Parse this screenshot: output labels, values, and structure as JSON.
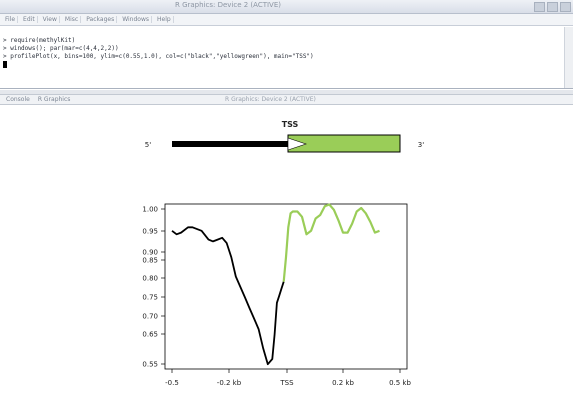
{
  "window": {
    "title": "R Graphics: Device 2 (ACTIVE)"
  },
  "menubar": [
    "File",
    "Edit",
    "View",
    "Misc",
    "Packages",
    "Windows",
    "Help"
  ],
  "console": {
    "lines": [
      "> require(methylKit)",
      "> windows(); par(mar=c(4,4,2,2))",
      "> profilePlot(x, bins=100, ylim=c(0.55,1.0), col=c(\"black\",\"yellowgreen\"), main=\"TSS\")"
    ]
  },
  "graph_tabs": {
    "items": [
      "Console",
      "R Graphics"
    ],
    "center": "R Graphics: Device 2 (ACTIVE)"
  },
  "gene_model": {
    "title": "TSS",
    "left_label": "5'",
    "right_label": "3'"
  },
  "chart_data": {
    "type": "line",
    "title": "",
    "xlabel": "",
    "ylabel": "",
    "x_tick_labels": [
      "-0.5",
      "-0.2 kb",
      "TSS",
      "0.2 kb",
      "0.5 kb"
    ],
    "y_tick_labels": [
      "0.55",
      "0.65",
      "0.70",
      "0.75",
      "0.80",
      "0.85",
      "0.90",
      "0.95",
      "1.00"
    ],
    "ylim": [
      0.55,
      1.0
    ],
    "x": [
      0,
      0.02,
      0.04,
      0.07,
      0.09,
      0.13,
      0.16,
      0.18,
      0.2,
      0.22,
      0.24,
      0.26,
      0.28,
      0.3,
      0.32,
      0.34,
      0.36,
      0.38,
      0.4,
      0.42,
      0.44,
      0.45,
      0.46,
      0.47,
      0.48,
      0.49,
      0.5,
      0.51,
      0.52,
      0.53,
      0.55,
      0.57,
      0.59,
      0.61,
      0.63,
      0.65,
      0.67,
      0.69,
      0.71,
      0.73,
      0.75,
      0.77,
      0.79,
      0.81,
      0.83,
      0.85,
      0.87,
      0.89,
      0.91,
      0.93,
      0.95,
      0.97,
      0.99,
      1.0
    ],
    "series": [
      {
        "color": "#000000",
        "range": [
          0,
          0.49
        ],
        "values": [
          0.935,
          0.925,
          0.93,
          0.945,
          0.945,
          0.935,
          0.91,
          0.905,
          0.91,
          0.915,
          0.9,
          0.86,
          0.805,
          0.775,
          0.745,
          0.715,
          0.685,
          0.655,
          0.6,
          0.555,
          0.57,
          0.64,
          0.73,
          0.75,
          0.77,
          0.79
        ]
      },
      {
        "color": "#9acd58",
        "range": [
          0.49,
          1.0
        ],
        "values": [
          0.79,
          0.86,
          0.945,
          0.985,
          0.99,
          0.99,
          0.975,
          0.925,
          0.935,
          0.97,
          0.98,
          1.005,
          1.01,
          0.995,
          0.965,
          0.93,
          0.93,
          0.955,
          0.99,
          1.0,
          0.985,
          0.96,
          0.93,
          0.935
        ]
      }
    ],
    "grid": false
  },
  "colors": {
    "upstream": "#000000",
    "downstream": "#9acd58"
  }
}
